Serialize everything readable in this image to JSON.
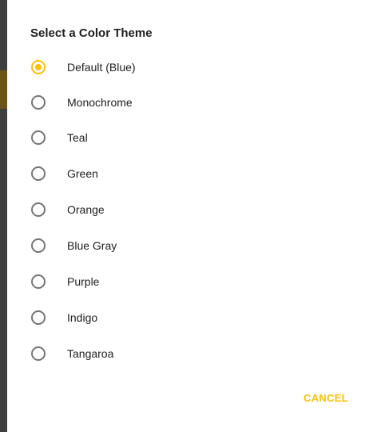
{
  "dialog": {
    "title": "Select a Color Theme",
    "selected_index": 0,
    "options": [
      {
        "label": "Default (Blue)",
        "selected": true
      },
      {
        "label": "Monochrome",
        "selected": false
      },
      {
        "label": "Teal",
        "selected": false
      },
      {
        "label": "Green",
        "selected": false
      },
      {
        "label": "Orange",
        "selected": false
      },
      {
        "label": "Blue Gray",
        "selected": false
      },
      {
        "label": "Purple",
        "selected": false
      },
      {
        "label": "Indigo",
        "selected": false
      },
      {
        "label": "Tangaroa",
        "selected": false
      }
    ],
    "cancel_label": "CANCEL"
  },
  "colors": {
    "accent": "#ffc107",
    "text": "#212121",
    "radio_unchecked": "#757575",
    "background_edge": "#3f3f3f"
  }
}
